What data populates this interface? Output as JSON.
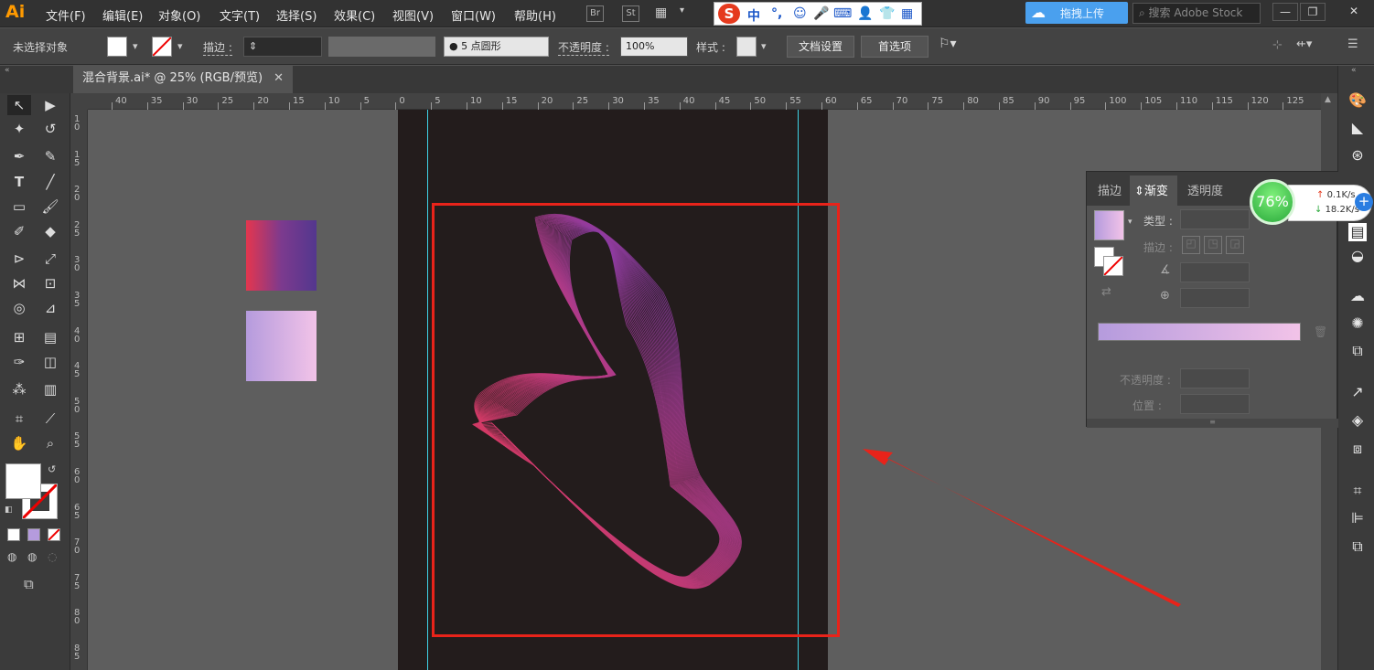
{
  "app": {
    "logo": "Ai"
  },
  "menu": [
    "文件(F)",
    "编辑(E)",
    "对象(O)",
    "文字(T)",
    "选择(S)",
    "效果(C)",
    "视图(V)",
    "窗口(W)",
    "帮助(H)"
  ],
  "bridge": {
    "br": "Br",
    "st": "St"
  },
  "ime": {
    "logo": "S",
    "glyphs": [
      "中",
      "°,",
      "☺",
      "🎤",
      "⌨",
      "👤",
      "👕",
      "▦"
    ]
  },
  "cloud": {
    "label": "拖拽上传"
  },
  "search": {
    "placeholder": "搜索 Adobe Stock"
  },
  "window_buttons": [
    "—",
    "❐",
    "✕"
  ],
  "control_bar": {
    "no_selection": "未选择对象",
    "stroke_label": "描边 :",
    "brush_value": "5 点圆形",
    "opacity_label": "不透明度 :",
    "opacity_value": "100%",
    "style_label": "样式 :",
    "doc_settings": "文档设置",
    "preferences": "首选项"
  },
  "document_tab": {
    "title": "混合背景.ai* @ 25% (RGB/预览)",
    "close": "✕"
  },
  "ruler": {
    "h_ticks": [
      "40",
      "35",
      "30",
      "25",
      "20",
      "15",
      "10",
      "5",
      "0",
      "5",
      "10",
      "15",
      "20",
      "25",
      "30",
      "35",
      "40",
      "45",
      "50",
      "55",
      "60",
      "65",
      "70",
      "75",
      "80",
      "85",
      "90",
      "95",
      "100",
      "105",
      "110",
      "115",
      "120",
      "125"
    ],
    "v_ticks": [
      "10",
      "15",
      "20",
      "25",
      "30",
      "35",
      "40",
      "45",
      "50",
      "55",
      "60",
      "65",
      "70",
      "75",
      "80",
      "85"
    ]
  },
  "gradient_panel": {
    "tabs": [
      "描边",
      "渐变",
      "透明度"
    ],
    "active_tab": "渐变",
    "type_label": "类型 :",
    "stroke_label": "描边 :",
    "opacity_label": "不透明度 :",
    "position_label": "位置 :",
    "gradient_start": "#b59bdd",
    "gradient_end": "#f2c3e8"
  },
  "net_monitor": {
    "percent": "76%",
    "upload": "0.1K/s",
    "download": "18.2K/s",
    "plus": "+"
  },
  "swatches": {
    "square1": [
      "#e4364e",
      "#53378e"
    ],
    "square2": [
      "#b59bdd",
      "#f2c3e8"
    ]
  },
  "colors": {
    "artboard": "#231c1c",
    "highlight": "#e8231a",
    "guide": "#3fd2e6"
  }
}
